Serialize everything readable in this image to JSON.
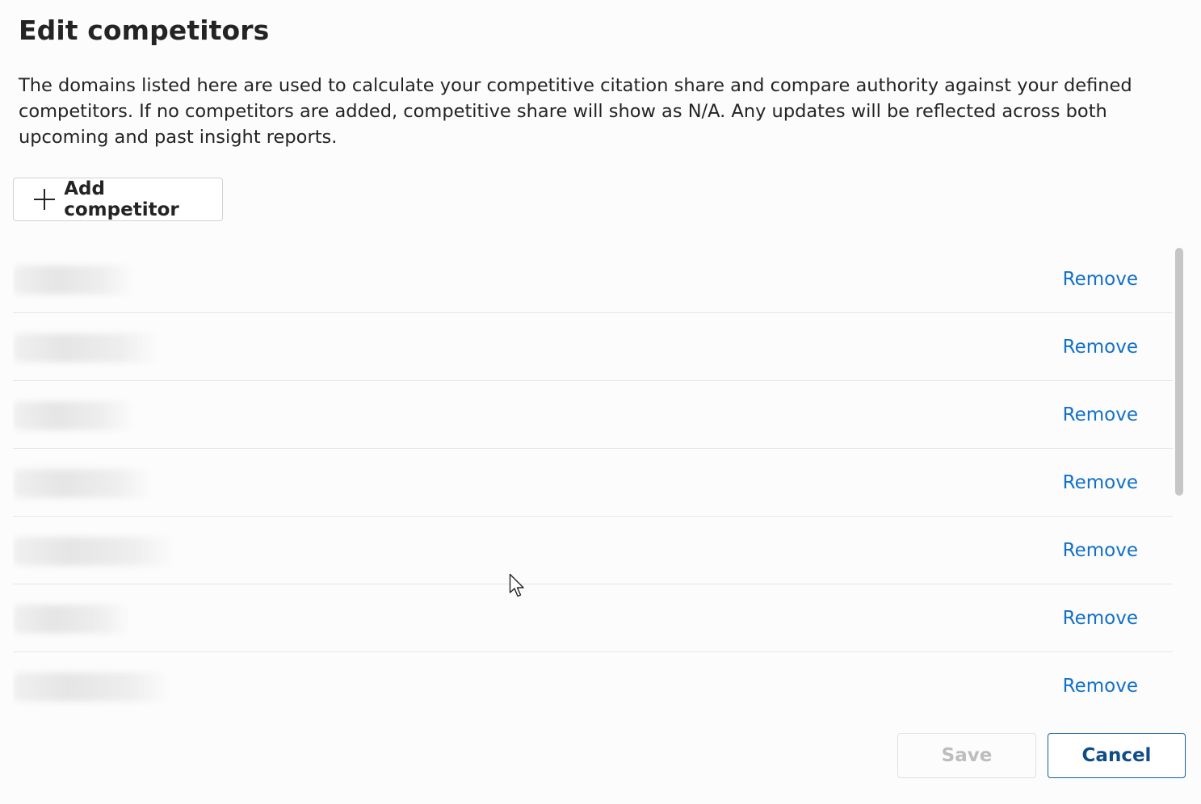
{
  "dialog": {
    "title": "Edit competitors",
    "description": "The domains listed here are used to calculate your competitive citation share and compare authority against your defined competitors. If no competitors are added, competitive share will show as N/A. Any updates will be reflected across both upcoming and past insight reports.",
    "add_button": {
      "label": "Add competitor",
      "icon": "plus-icon"
    }
  },
  "competitors": [
    {
      "domain": "",
      "remove_label": "Remove"
    },
    {
      "domain": "",
      "remove_label": "Remove"
    },
    {
      "domain": "",
      "remove_label": "Remove"
    },
    {
      "domain": "",
      "remove_label": "Remove"
    },
    {
      "domain": "",
      "remove_label": "Remove"
    },
    {
      "domain": "",
      "remove_label": "Remove"
    },
    {
      "domain": "",
      "remove_label": "Remove"
    }
  ],
  "footer": {
    "save_label": "Save",
    "save_disabled": true,
    "cancel_label": "Cancel"
  },
  "colors": {
    "link": "#1170c8",
    "primary_border": "#0f5fa6",
    "text": "#242424"
  }
}
